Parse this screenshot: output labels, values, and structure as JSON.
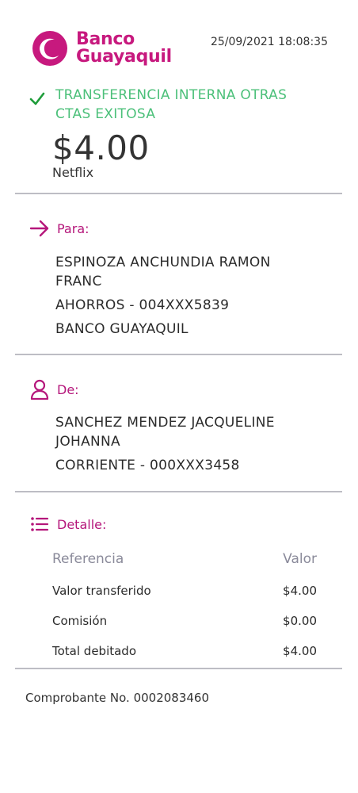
{
  "header": {
    "bank_name_line1": "Banco",
    "bank_name_line2": "Guayaquil",
    "datetime": "25/09/2021 18:08:35",
    "brand_color": "#c7197e"
  },
  "status": {
    "title_line1": "TRANSFERENCIA INTERNA OTRAS",
    "title_line2": "CTAS EXITOSA",
    "success_color": "#4cc07a",
    "amount": "$4.00",
    "note": "Netflix"
  },
  "to": {
    "label": "Para:",
    "name_line1": "ESPINOZA ANCHUNDIA RAMON",
    "name_line2": "FRANC",
    "account": "AHORROS - 004XXX5839",
    "bank": "BANCO GUAYAQUIL"
  },
  "from": {
    "label": "De:",
    "name_line1": "SANCHEZ MENDEZ JACQUELINE",
    "name_line2": "JOHANNA",
    "account": "CORRIENTE - 000XXX3458"
  },
  "detail": {
    "label": "Detalle:",
    "col_ref": "Referencia",
    "col_val": "Valor",
    "rows": [
      {
        "ref": "Valor transferido",
        "val": "$4.00"
      },
      {
        "ref": "Comisión",
        "val": "$0.00"
      },
      {
        "ref": "Total debitado",
        "val": "$4.00"
      }
    ]
  },
  "voucher": "Comprobante No. 0002083460"
}
